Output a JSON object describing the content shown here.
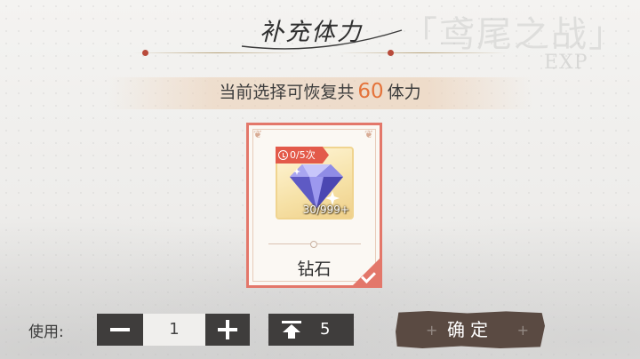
{
  "header": {
    "title": "补充体力",
    "watermark": "「鸢尾之战」",
    "watermark_sub": "EXP"
  },
  "info": {
    "prefix": "当前选择可恢复共",
    "amount": "60",
    "suffix": "体力",
    "amount_color": "#e4733b"
  },
  "item_card": {
    "name": "钻石",
    "limit": "0/5次",
    "count": "30/999+",
    "icon": "diamond-icon",
    "selected": true,
    "border_color": "#e3776a"
  },
  "quantity": {
    "label": "使用:",
    "value": "1",
    "max_value": "5"
  },
  "confirm": {
    "label": "确定"
  }
}
